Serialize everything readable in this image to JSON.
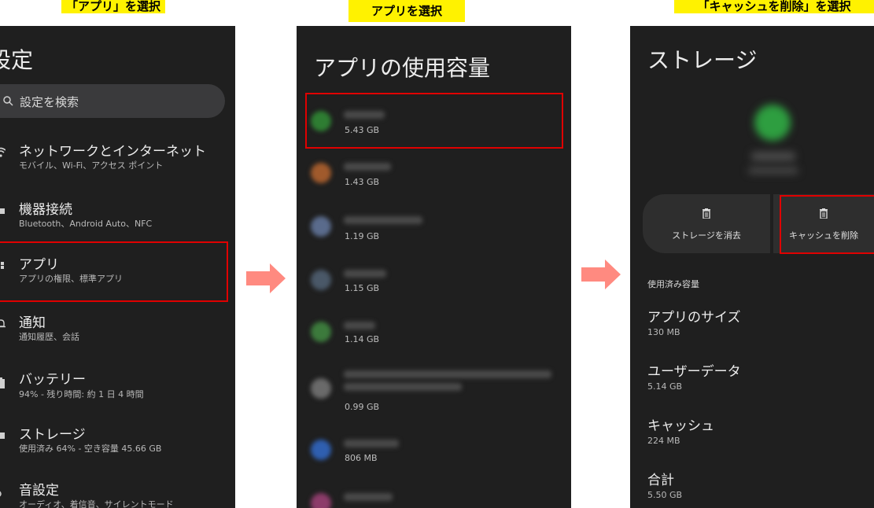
{
  "captions": {
    "step1": "「アプリ」を選択",
    "step2": "アプリを選択",
    "step3": "「キャッシュを削除」を選択"
  },
  "settings": {
    "title": "設定",
    "search_placeholder": "設定を検索",
    "items": [
      {
        "title": "ネットワークとインターネット",
        "subtitle": "モバイル、Wi-Fi、アクセス ポイント",
        "icon": "wifi-icon"
      },
      {
        "title": "機器接続",
        "subtitle": "Bluetooth、Android Auto、NFC",
        "icon": "devices-icon"
      },
      {
        "title": "アプリ",
        "subtitle": "アプリの権限、標準アプリ",
        "icon": "apps-icon"
      },
      {
        "title": "通知",
        "subtitle": "通知履歴、会話",
        "icon": "bell-icon"
      },
      {
        "title": "バッテリー",
        "subtitle": "94% - 残り時間: 約 1 日 4 時間",
        "icon": "battery-icon"
      },
      {
        "title": "ストレージ",
        "subtitle": "使用済み 64% - 空き容量 45.66 GB",
        "icon": "storage-icon"
      },
      {
        "title": "音設定",
        "subtitle": "オーディオ、着信音、サイレントモード",
        "icon": "sound-icon"
      }
    ]
  },
  "app_usage": {
    "title": "アプリの使用容量",
    "apps": [
      {
        "size": "5.43 GB",
        "color": "#2e7d32"
      },
      {
        "size": "1.43 GB",
        "color": "#a05a2c"
      },
      {
        "size": "1.19 GB",
        "color": "#5a6b8c"
      },
      {
        "size": "1.15 GB",
        "color": "#4a5868"
      },
      {
        "size": "1.14 GB",
        "color": "#3c7a3c"
      },
      {
        "size": "0.99 GB",
        "color": "#6a6a6a"
      },
      {
        "size": "806 MB",
        "color": "#2f5fb0"
      },
      {
        "size": "",
        "color": "#8c3c6a"
      }
    ]
  },
  "storage": {
    "title": "ストレージ",
    "clear_storage_label": "ストレージを消去",
    "clear_cache_label": "キャッシュを削除",
    "section_header": "使用済み容量",
    "rows": [
      {
        "label": "アプリのサイズ",
        "value": "130 MB"
      },
      {
        "label": "ユーザーデータ",
        "value": "5.14 GB"
      },
      {
        "label": "キャッシュ",
        "value": "224 MB"
      },
      {
        "label": "合計",
        "value": "5.50 GB"
      }
    ]
  },
  "colors": {
    "highlight": "#fff200",
    "frame": "#e00000",
    "arrow": "#ff8a80",
    "screen_bg": "#1f1f1f"
  }
}
